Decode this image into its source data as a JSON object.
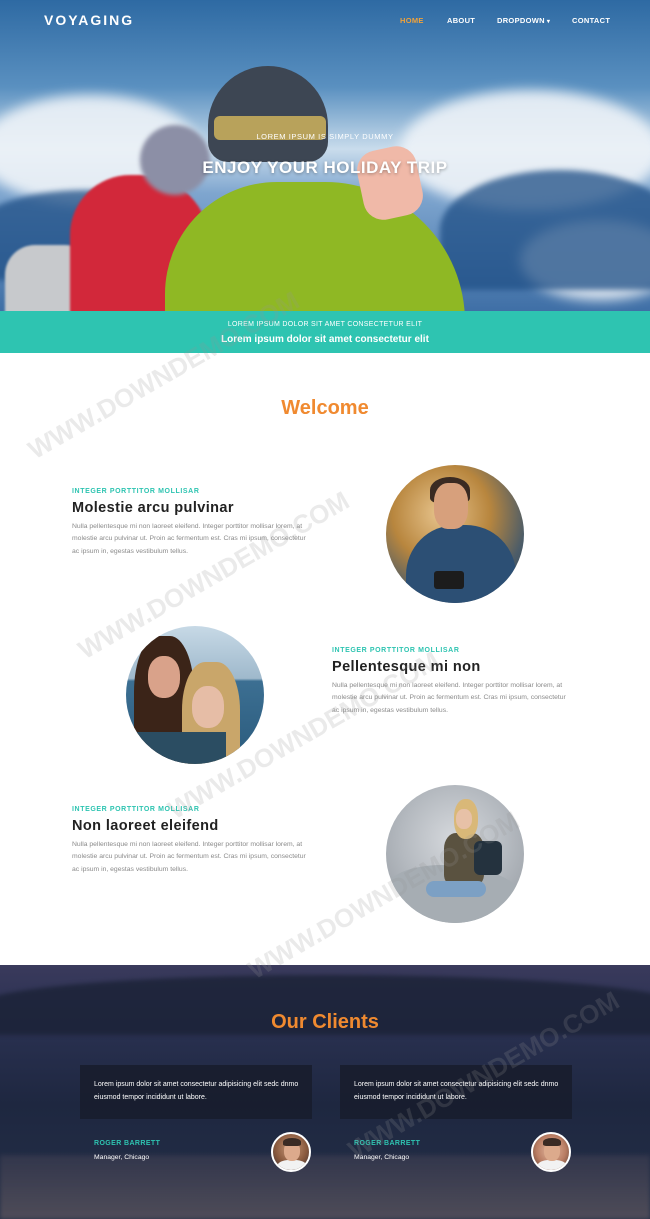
{
  "brand": {
    "logo": "VOYAGING",
    "accent": "#f08a30",
    "teal": "#2ec4b1"
  },
  "nav": {
    "items": [
      {
        "label": "HOME",
        "active": true
      },
      {
        "label": "ABOUT",
        "active": false
      },
      {
        "label": "DROPDOWN",
        "active": false,
        "has_caret": true
      },
      {
        "label": "CONTACT",
        "active": false
      }
    ],
    "caret_icon": "chevron-down-icon"
  },
  "hero": {
    "subtitle": "LOREM IPSUM IS SIMPLY DUMMY",
    "title": "ENJOY YOUR HOLIDAY TRIP"
  },
  "banner": {
    "small": "LOREM IPSUM DOLOR SIT AMET CONSECTETUR ELIT",
    "big": "Lorem ipsum dolor sit amet consectetur elit"
  },
  "welcome": {
    "title": "Welcome",
    "features": [
      {
        "eyebrow": "INTEGER PORTTITOR MOLLISAR",
        "heading": "Molestie arcu pulvinar",
        "body": "Nulla pellentesque mi non laoreet eleifend. Integer porttitor mollisar lorem, at molestie arcu pulvinar ut. Proin ac fermentum est. Cras mi ipsum, consectetur ac ipsum in, egestas vestibulum tellus."
      },
      {
        "eyebrow": "INTEGER PORTTITOR MOLLISAR",
        "heading": "Pellentesque mi non",
        "body": "Nulla pellentesque mi non laoreet eleifend. Integer porttitor mollisar lorem, at molestie arcu pulvinar ut. Proin ac fermentum est. Cras mi ipsum, consectetur ac ipsum in, egestas vestibulum tellus."
      },
      {
        "eyebrow": "INTEGER PORTTITOR MOLLISAR",
        "heading": "Non laoreet eleifend",
        "body": "Nulla pellentesque mi non laoreet eleifend. Integer porttitor mollisar lorem, at molestie arcu pulvinar ut. Proin ac fermentum est. Cras mi ipsum, consectetur ac ipsum in, egestas vestibulum tellus."
      }
    ]
  },
  "clients": {
    "title": "Our Clients",
    "testimonials": [
      {
        "quote": "Lorem ipsum dolor sit amet consectetur adipisicing elit sedc dnmo eiusmod tempor incididunt ut labore.",
        "name": "ROGER BARRETT",
        "role": "Manager, Chicago"
      },
      {
        "quote": "Lorem ipsum dolor sit amet consectetur adipisicing elit sedc dnmo eiusmod tempor incididunt ut labore.",
        "name": "ROGER BARRETT",
        "role": "Manager, Chicago"
      }
    ]
  },
  "watermark": "WWW.DOWNDEMO.COM"
}
